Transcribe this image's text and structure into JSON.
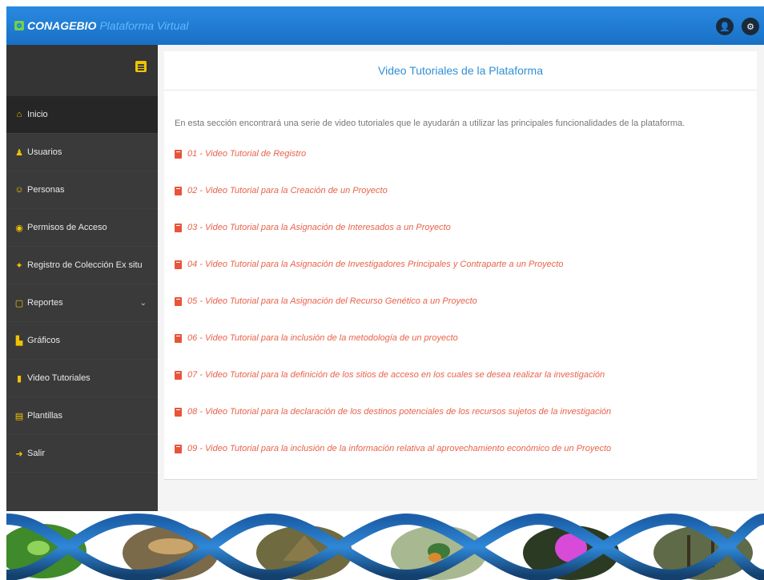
{
  "header": {
    "brand_name": "CONAGEBIO",
    "brand_subtitle": "Plataforma Virtual",
    "user_icon_glyph": "👤",
    "settings_icon_glyph": "⚙",
    "color": "#1f7fd6"
  },
  "sidebar": {
    "menu_toggle_icon": "hamburger-icon",
    "items": [
      {
        "label": "Inicio",
        "icon": "home-icon",
        "glyph": "⌂"
      },
      {
        "label": "Usuarios",
        "icon": "users-icon",
        "glyph": "♟"
      },
      {
        "label": "Personas",
        "icon": "people-icon",
        "glyph": "☺"
      },
      {
        "label": "Permisos de Acceso",
        "icon": "access-icon",
        "glyph": "◉"
      },
      {
        "label": "Registro de Colección Ex situ",
        "icon": "bird-icon",
        "glyph": "✦"
      },
      {
        "label": "Reportes",
        "icon": "report-icon",
        "glyph": "▢",
        "caret": "⌄"
      },
      {
        "label": "Gráficos",
        "icon": "chart-icon",
        "glyph": "▙"
      },
      {
        "label": "Video Tutoriales",
        "icon": "book-icon",
        "glyph": "▮"
      },
      {
        "label": "Plantillas",
        "icon": "template-icon",
        "glyph": "▤"
      },
      {
        "label": "Salir",
        "icon": "exit-icon",
        "glyph": "➜"
      }
    ]
  },
  "main": {
    "title": "Video Tutoriales de la Plataforma",
    "intro": "En esta sección encontrará una serie de video tutoriales que le ayudarán a utilizar las principales funcionalidades de la plataforma.",
    "videos": [
      "01 - Video Tutorial de Registro",
      "02 - Video Tutorial para la Creación de un Proyecto",
      "03 - Video Tutorial para la Asignación de Interesados a un Proyecto",
      "04 - Video Tutorial para la Asignación de Investigadores Principales y Contraparte a un Proyecto",
      "05 - Video Tutorial para la Asignación del Recurso Genético a un Proyecto",
      "06 - Video Tutorial para la inclusión de la metodología de un proyecto",
      "07 - Video Tutorial para la definición de los sitios de acceso en los cuales se desea realizar la investigación",
      "08 - Video Tutorial para la declaración de los destinos potenciales de los recursos sujetos de la investigación",
      "09 - Video Tutorial para la inclusión de la información relativa al aprovechamiento económico de un Proyecto"
    ]
  }
}
